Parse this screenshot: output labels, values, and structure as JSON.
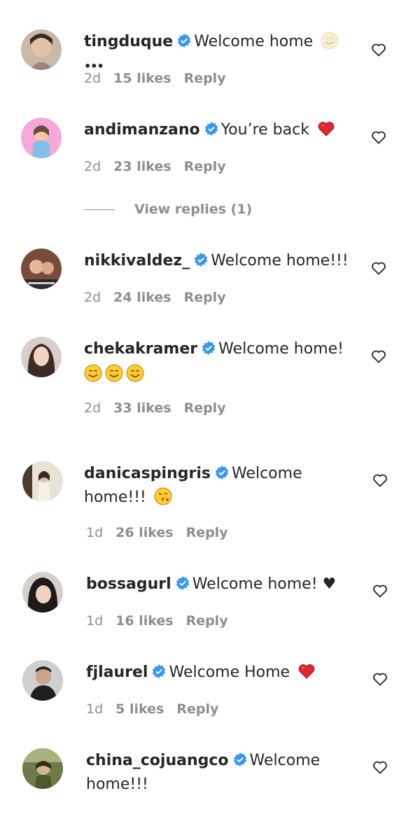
{
  "comments": [
    {
      "username": "tingduque",
      "text": "Welcome home",
      "emoji": "smile-faded-icon",
      "trunc": "•••",
      "time": "2d",
      "likes": "15 likes",
      "reply": "Reply"
    },
    {
      "username": "andimanzano",
      "text": "You’re back",
      "emoji": "red-heart-icon",
      "time": "2d",
      "likes": "23 likes",
      "reply": "Reply"
    },
    {
      "username": "nikkivaldez_",
      "text": "Welcome home!!!",
      "time": "2d",
      "likes": "24 likes",
      "reply": "Reply"
    },
    {
      "username": "chekakramer",
      "text": "Welcome home!",
      "emoji": "smiling-face-icon",
      "emoji_count": 3,
      "time": "2d",
      "likes": "33 likes",
      "reply": "Reply"
    },
    {
      "username": "danicaspingris",
      "text": "Welcome",
      "text2": "home!!!",
      "emoji": "face-blowing-kiss-icon",
      "time": "1d",
      "likes": "26 likes",
      "reply": "Reply"
    },
    {
      "username": "bossagurl",
      "text": "Welcome home! ♥",
      "time": "1d",
      "likes": "16 likes",
      "reply": "Reply"
    },
    {
      "username": "fjlaurel",
      "text": "Welcome Home",
      "emoji": "red-heart-icon",
      "time": "1d",
      "likes": "5 likes",
      "reply": "Reply"
    },
    {
      "username": "china_cojuangco",
      "text": "Welcome",
      "text2": "home!!!"
    }
  ],
  "view_replies": "View replies (1)",
  "colors": {
    "verified": "#3897f0",
    "muted": "#8e8e8e",
    "text": "#262626",
    "heart_red": "#ed4956"
  }
}
